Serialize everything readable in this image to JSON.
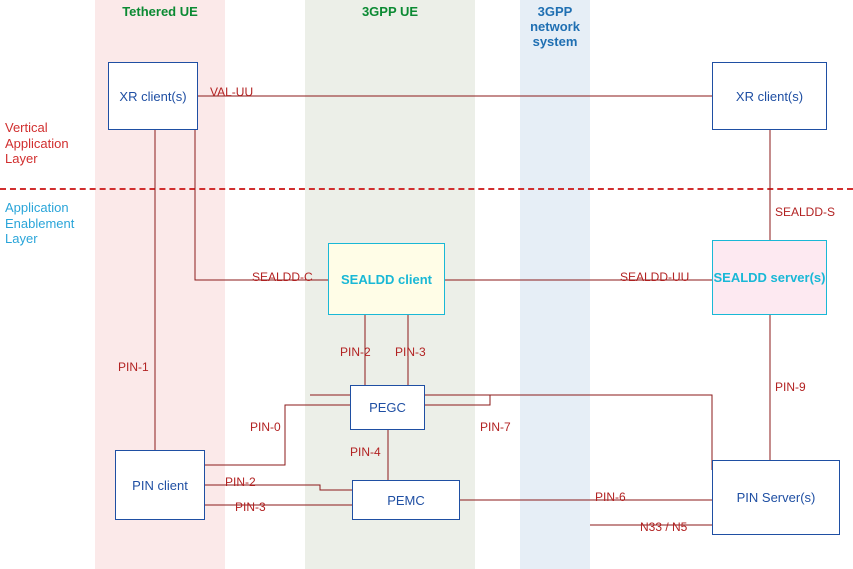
{
  "columns": {
    "tethered": {
      "label": "Tethered UE"
    },
    "ue3gpp": {
      "label": "3GPP UE"
    },
    "net3gpp": {
      "label": "3GPP network system"
    }
  },
  "layers": {
    "vertical": {
      "line1": "Vertical",
      "line2": "Application",
      "line3": "Layer"
    },
    "enablement": {
      "line1": "Application",
      "line2": "Enablement",
      "line3": "Layer"
    }
  },
  "nodes": {
    "xr_left": {
      "label": "XR client(s)"
    },
    "xr_right": {
      "label": "XR client(s)"
    },
    "sealdd_client": {
      "label": "SEALDD client"
    },
    "sealdd_server": {
      "label": "SEALDD server(s)"
    },
    "pin_client": {
      "label": "PIN client"
    },
    "pin_server": {
      "label": "PIN Server(s)"
    },
    "pegc": {
      "label": "PEGC"
    },
    "pemc": {
      "label": "PEMC"
    }
  },
  "links": {
    "val_uu": "VAL-UU",
    "sealdd_c": "SEALDD-C",
    "sealdd_uu": "SEALDD-UU",
    "sealdd_s": "SEALDD-S",
    "pin0": "PIN-0",
    "pin1": "PIN-1",
    "pin2_left": "PIN-2",
    "pin2": "PIN-2",
    "pin3_left": "PIN-3",
    "pin3": "PIN-3",
    "pin4": "PIN-4",
    "pin6": "PIN-6",
    "pin7": "PIN-7",
    "pin9": "PIN-9",
    "n33n5": "N33 / N5"
  }
}
